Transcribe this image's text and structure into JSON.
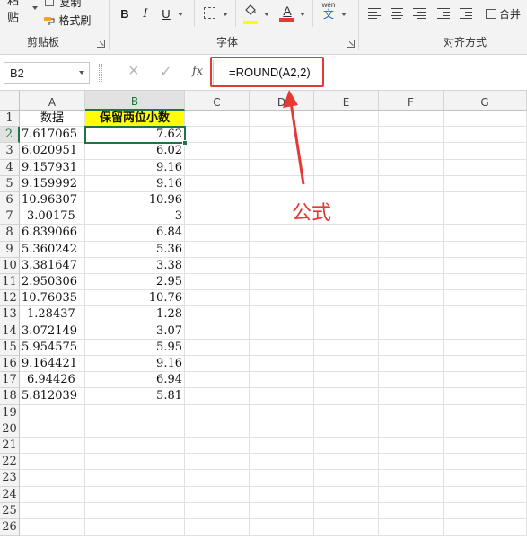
{
  "ribbon": {
    "clipboard": {
      "paste": "粘贴",
      "copy": "复制",
      "format_painter": "格式刷",
      "label": "剪贴板"
    },
    "font": {
      "bold": "B",
      "italic": "I",
      "underline": "U",
      "wen": "wén",
      "wen_char": "文",
      "font_color_letter": "A",
      "label": "字体"
    },
    "alignment": {
      "label": "对齐方式",
      "merge": "合并"
    },
    "colors": {
      "highlight": "#ffff00",
      "font_color": "#e53935"
    }
  },
  "formula_bar": {
    "name_box": "B2",
    "cancel_icon": "×",
    "confirm_icon": "✓",
    "fx": "fx",
    "formula": "=ROUND(A2,2)"
  },
  "grid": {
    "columns": [
      "A",
      "B",
      "C",
      "D",
      "E",
      "F",
      "G"
    ],
    "rows": [
      "1",
      "2",
      "3",
      "4",
      "5",
      "6",
      "7",
      "8",
      "9",
      "10",
      "11",
      "12",
      "13",
      "14",
      "15",
      "16",
      "17",
      "18",
      "19",
      "20",
      "21",
      "22",
      "23",
      "24",
      "25",
      "26"
    ],
    "header_a": "数据",
    "header_b": "保留两位小数",
    "values_a": [
      "7.617065",
      "6.020951",
      "9.157931",
      "9.159992",
      "10.96307",
      "3.00175",
      "6.839066",
      "5.360242",
      "3.381647",
      "2.950306",
      "10.76035",
      "1.28437",
      "3.072149",
      "5.954575",
      "9.164421",
      "6.94426",
      "5.812039"
    ],
    "values_b": [
      "7.62",
      "6.02",
      "9.16",
      "9.16",
      "10.96",
      "3",
      "6.84",
      "5.36",
      "3.38",
      "2.95",
      "10.76",
      "1.28",
      "3.07",
      "5.95",
      "9.16",
      "6.94",
      "5.81"
    ],
    "selected_cell": "B2",
    "accent": "#217346"
  },
  "annotation": {
    "label": "公式",
    "color": "#e53935"
  }
}
